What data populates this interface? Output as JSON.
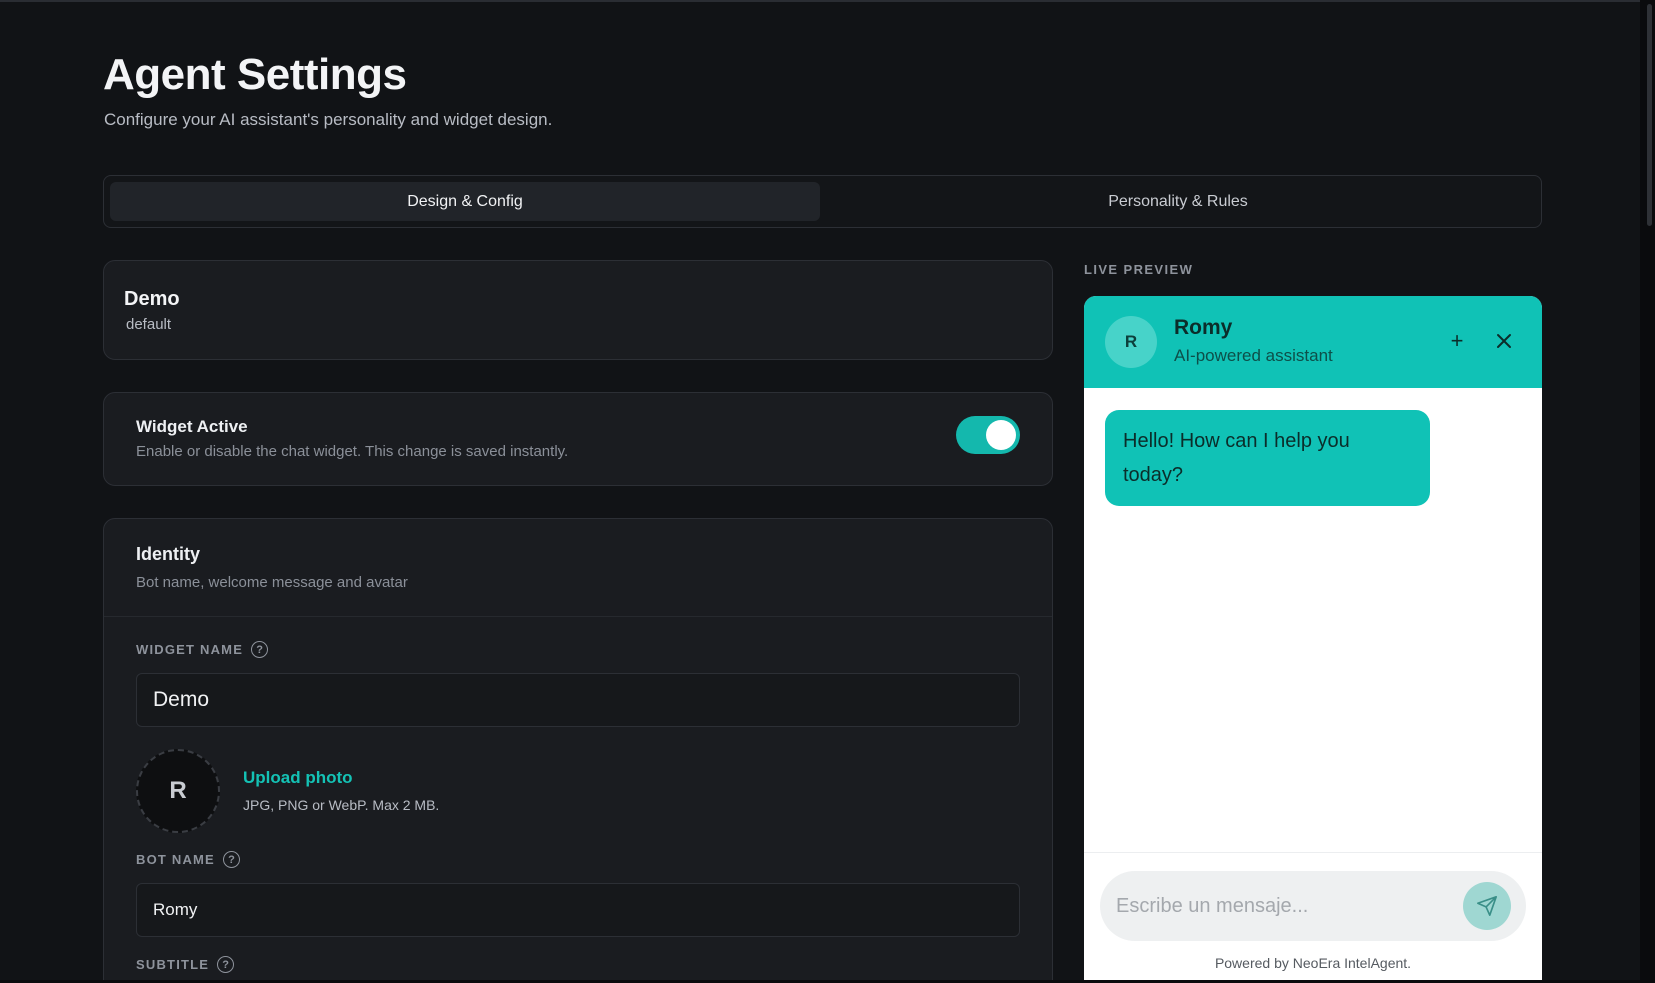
{
  "page": {
    "title": "Agent Settings",
    "subtitle": "Configure your AI assistant's personality and widget design."
  },
  "tabs": [
    {
      "label": "Design & Config",
      "active": true
    },
    {
      "label": "Personality & Rules",
      "active": false
    }
  ],
  "agent": {
    "name": "Demo",
    "slug": "default"
  },
  "widget_status": {
    "title": "Widget Active",
    "description": "Enable or disable the chat widget. This change is saved instantly.",
    "enabled": true
  },
  "identity": {
    "title": "Identity",
    "description": "Bot name, welcome message and avatar",
    "widget_name_label": "WIDGET NAME",
    "widget_name_value": "Demo",
    "avatar_letter": "R",
    "upload_label": "Upload photo",
    "upload_hint": "JPG, PNG or WebP. Max 2 MB.",
    "bot_name_label": "BOT NAME",
    "bot_name_value": "Romy",
    "subtitle_label": "SUBTITLE",
    "help_glyph": "?"
  },
  "preview": {
    "label": "LIVE PREVIEW",
    "avatar_letter": "R",
    "bot_name": "Romy",
    "bot_subtitle": "AI-powered assistant",
    "plus_glyph": "+",
    "welcome_message": "Hello! How can I help you today?",
    "input_placeholder": "Escribe un mensaje...",
    "powered_by": "Powered by NeoEra IntelAgent."
  },
  "colors": {
    "accent": "#10c2b6",
    "background": "#111316",
    "card": "#1a1c20",
    "border": "#2c2f35"
  },
  "icons": [
    "help-icon",
    "plus-icon",
    "close-icon",
    "send-icon"
  ]
}
